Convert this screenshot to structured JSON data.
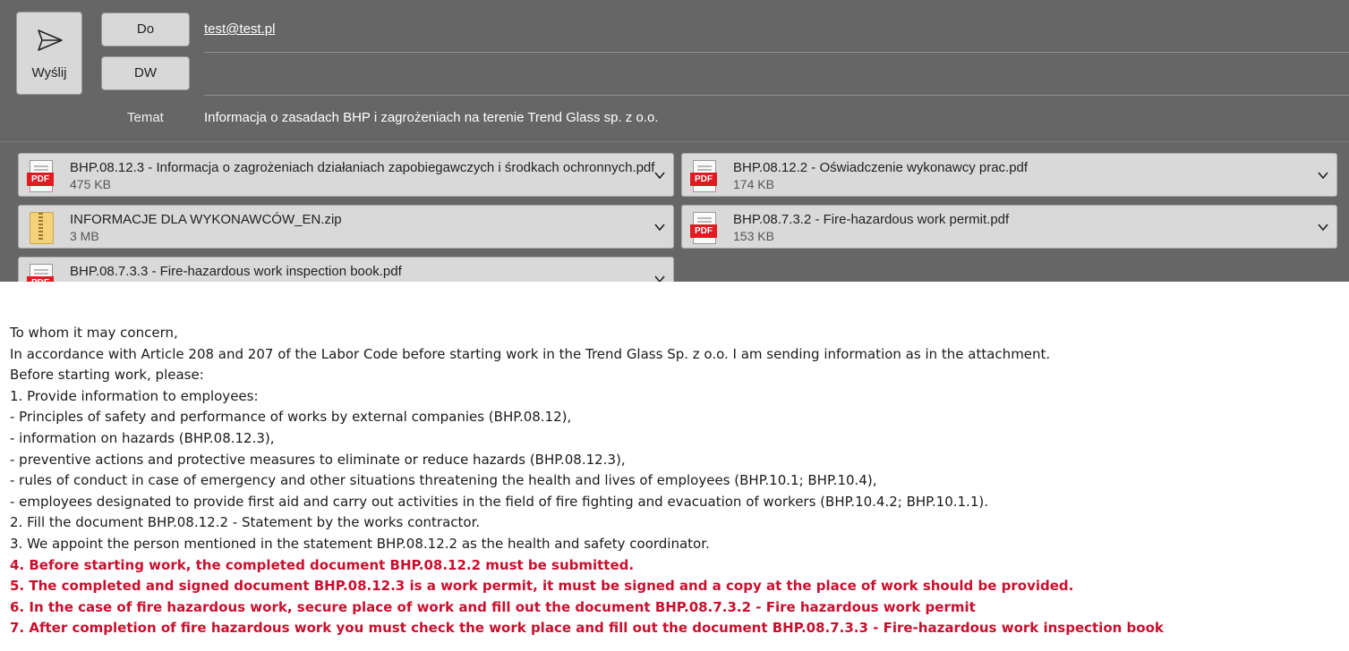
{
  "compose": {
    "send_label": "Wyślij",
    "to_button": "Do",
    "cc_button": "DW",
    "to_value": "test@test.pl",
    "cc_value": "",
    "subject_label": "Temat",
    "subject_value": "Informacja o zasadach BHP i zagrożeniach na terenie Trend Glass sp. z o.o."
  },
  "attachments": [
    {
      "name": "BHP.08.12.3 - Informacja o zagrożeniach działaniach zapobiegawczych i środkach ochronnych.pdf",
      "size": "475 KB",
      "type": "pdf",
      "icon": "pdf-file-icon"
    },
    {
      "name": "BHP.08.12.2 - Oświadczenie wykonawcy prac.pdf",
      "size": "174 KB",
      "type": "pdf",
      "icon": "pdf-file-icon"
    },
    {
      "name": "INFORMACJE DLA WYKONAWCÓW_EN.zip",
      "size": "3 MB",
      "type": "zip",
      "icon": "zip-folder-icon"
    },
    {
      "name": "BHP.08.7.3.2 - Fire-hazardous work permit.pdf",
      "size": "153 KB",
      "type": "pdf",
      "icon": "pdf-file-icon"
    },
    {
      "name": "BHP.08.7.3.3 - Fire-hazardous work inspection book.pdf",
      "size": "",
      "type": "pdf",
      "icon": "pdf-file-icon"
    }
  ],
  "icon_tag": "PDF",
  "body_lines": [
    "To whom it may concern,",
    "In accordance with Article 208 and 207 of the Labor Code before starting work in the Trend Glass Sp. z o.o. I am sending information as in the attachment.",
    "Before starting work, please:",
    "1. Provide information to employees:",
    "- Principles of safety and performance of works by external companies (BHP.08.12),",
    "- information on hazards (BHP.08.12.3),",
    "- preventive actions and protective measures to eliminate or reduce hazards (BHP.08.12.3),",
    "- rules of conduct in case of emergency and other situations threatening the health and lives of employees (BHP.10.1; BHP.10.4),",
    "- employees designated to provide first aid and carry out activities in the field of fire fighting and evacuation of workers (BHP.10.4.2; BHP.10.1.1).",
    "2. Fill the document BHP.08.12.2 - Statement by the works contractor.",
    "3. We appoint the person mentioned in the statement BHP.08.12.2 as the health and safety coordinator.",
    "4. Before starting work, the completed document BHP.08.12.2 must be submitted.",
    "5. The completed and signed document BHP.08.12.3 is a work permit, it must be signed and a copy at the place of work should be provided.",
    "6. In the case of fire hazardous work, secure place of work and fill out the document BHP.08.7.3.2 - Fire hazardous work permit",
    "7. After completion of fire hazardous work you must check the work place and fill out the document BHP.08.7.3.3 - Fire-hazardous work inspection book"
  ],
  "colors": {
    "header_bg": "#666666",
    "button_bg": "#d8d8d8",
    "highlight_red": "#c8102e",
    "pdf_red": "#e01b22"
  }
}
